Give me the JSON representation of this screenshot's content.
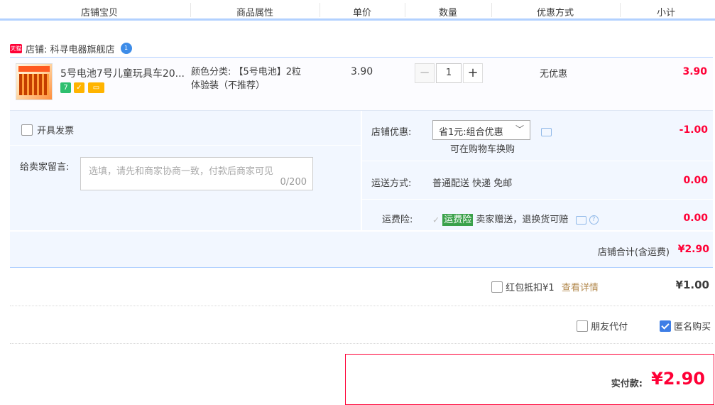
{
  "header": {
    "columns": [
      "店铺宝贝",
      "商品属性",
      "单价",
      "数量",
      "优惠方式",
      "小计"
    ]
  },
  "shop": {
    "tmall_label": "天猫",
    "name": "店铺: 科寻电器旗舰店",
    "badge": "1"
  },
  "item": {
    "title": "5号电池7号儿童玩具车20...",
    "icon_badge_1": "7",
    "attr_line1": "颜色分类: 【5号电池】2粒",
    "attr_line2": "体验装（不推荐）",
    "price": "3.90",
    "quantity": "1",
    "discount": "无优惠",
    "subtotal": "3.90"
  },
  "invoice": {
    "label": "开具发票"
  },
  "message": {
    "label": "给卖家留言:",
    "placeholder": "选填，请先和商家协商一致，付款后商家可见",
    "counter": "0/200"
  },
  "shop_discount": {
    "label": "店铺优惠:",
    "selected": "省1元:组合优惠",
    "note": "可在购物车换购",
    "amount": "-1.00"
  },
  "shipping": {
    "label": "运送方式:",
    "value": "普通配送 快递 免邮",
    "amount": "0.00"
  },
  "insurance": {
    "label": "运费险:",
    "tag": "运费险",
    "text": "卖家赠送，退换货可赔",
    "amount": "0.00"
  },
  "shop_total": {
    "label": "店铺合计(含运费)",
    "amount": "¥2.90"
  },
  "redpacket": {
    "label": "红包抵扣¥1",
    "link": "查看详情",
    "amount": "¥1.00"
  },
  "options": {
    "friend_pay": "朋友代付",
    "anonymous": "匿名购买"
  },
  "payment": {
    "label": "实付款:",
    "amount": "¥2.90"
  },
  "colors": {
    "accent": "#ff0036",
    "border_blue": "#b2d1ff",
    "panel_bg": "#f2f7ff",
    "check_blue": "#3e7ee6"
  }
}
